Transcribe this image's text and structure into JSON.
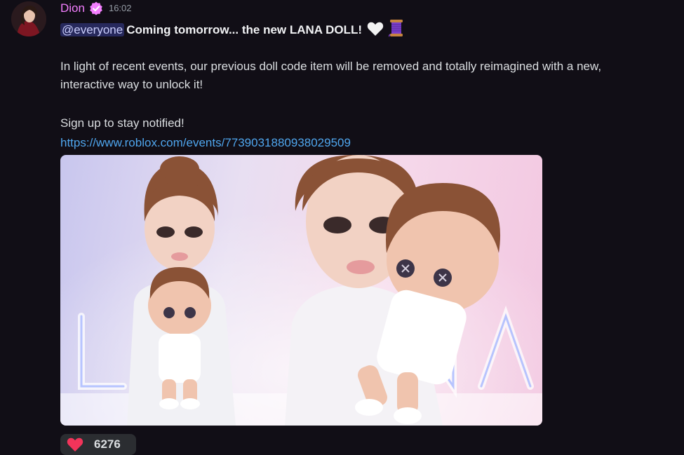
{
  "message": {
    "author": "Dion",
    "timestamp": "16:02",
    "author_color": "#f47fff",
    "mention": "@everyone",
    "headline": "Coming tomorrow... the new LANA DOLL!",
    "headline_emojis": [
      "white-heart-icon",
      "thread-spool-icon"
    ],
    "paragraph_line1": "In light of recent events, our previous doll code item will be removed and totally reimagined with a new,",
    "paragraph_line2": "interactive way to unlock it!",
    "cta": "Sign up to stay notified!",
    "link": "https://www.roblox.com/events/7739031880938029509"
  },
  "image": {
    "description_icon": "promo-image",
    "watermark_text": "LANA"
  },
  "reactions": [
    {
      "emoji": "red-heart-icon",
      "count": "6276",
      "color": "#f2345a"
    }
  ],
  "colors": {
    "background": "#110e16",
    "link": "#4fa6ee",
    "mention_bg": "#3a3f80",
    "verified_badge": "#f47fff"
  }
}
